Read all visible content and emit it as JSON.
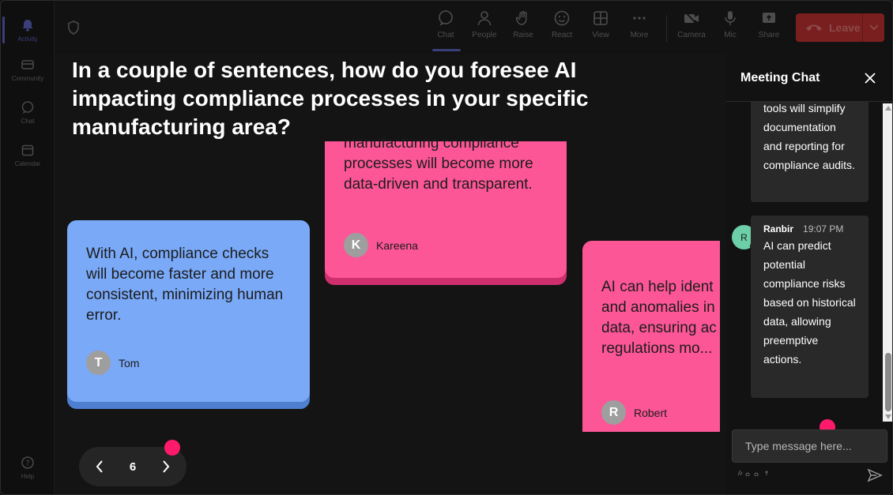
{
  "rail": {
    "items": [
      {
        "label": "Activity",
        "icon": "bell-icon"
      },
      {
        "label": "Community",
        "icon": "community-icon"
      },
      {
        "label": "Chat",
        "icon": "chat-icon"
      },
      {
        "label": "Calendar",
        "icon": "calendar-icon"
      },
      {
        "label": "Help",
        "icon": "help-icon"
      }
    ]
  },
  "toolbar": {
    "chat": "Chat",
    "people": "People",
    "raise": "Raise",
    "react": "React",
    "view": "View",
    "more": "More",
    "camera": "Camera",
    "mic": "Mic",
    "share": "Share",
    "leave": "Leave"
  },
  "stage": {
    "question": "In a couple of sentences, how do you foresee AI impacting compliance processes in your specific manufacturing area?",
    "cards": [
      {
        "text": "With AI, compliance checks will become faster and more consistent, minimizing human error.",
        "author": "Tom",
        "initial": "T",
        "color": "#7aa9f7"
      },
      {
        "text": "manufacturing compliance processes will become more data-driven and transparent.",
        "author": "Kareena",
        "initial": "K",
        "color": "#fc5696"
      },
      {
        "text_lines": [
          "AI can help ident",
          "and anomalies in",
          "data, ensuring ac",
          "regulations mo..."
        ],
        "author": "Robert",
        "initial": "R",
        "color": "#fc5696"
      }
    ],
    "pager": {
      "page": "6"
    }
  },
  "chat": {
    "title": "Meeting Chat",
    "message1": "tools will simplify documentation and reporting for compliance audits.",
    "message2": {
      "sender": "Ranbir",
      "initial": "R",
      "time": "19:07 PM",
      "text": "AI can predict potential compliance risks based on historical data, allowing preemptive actions."
    },
    "input_placeholder": "Type message here..."
  },
  "colors": {
    "accent": "#ff1a6b",
    "leave": "#7a1f1f",
    "avatar_ranbir": "#6ccfa7"
  }
}
